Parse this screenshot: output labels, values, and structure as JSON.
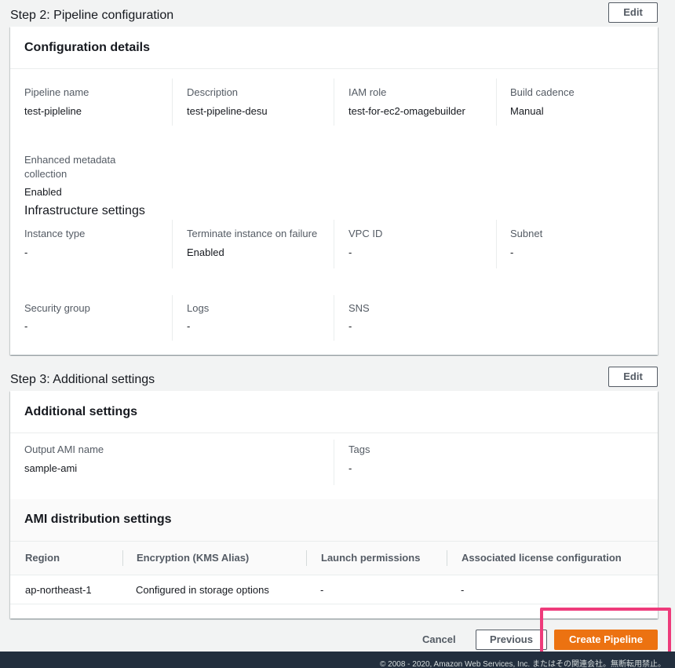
{
  "step2": {
    "title": "Step 2: Pipeline configuration",
    "edit_label": "Edit",
    "card_title": "Configuration details",
    "fields_row1": [
      {
        "label": "Pipeline name",
        "value": "test-pipleline"
      },
      {
        "label": "Description",
        "value": "test-pipeline-desu"
      },
      {
        "label": "IAM role",
        "value": "test-for-ec2-omagebuilder"
      },
      {
        "label": "Build cadence",
        "value": "Manual"
      }
    ],
    "enhanced": {
      "label_line1": "Enhanced metadata",
      "label_line2": "collection",
      "value": "Enabled"
    },
    "infra_title": "Infrastructure settings",
    "infra_row1": [
      {
        "label": "Instance type",
        "value": "-"
      },
      {
        "label": "Terminate instance on failure",
        "value": "Enabled"
      },
      {
        "label": "VPC ID",
        "value": "-"
      },
      {
        "label": "Subnet",
        "value": "-"
      }
    ],
    "infra_row2": [
      {
        "label": "Security group",
        "value": "-"
      },
      {
        "label": "Logs",
        "value": "-"
      },
      {
        "label": "SNS",
        "value": "-"
      }
    ]
  },
  "step3": {
    "title": "Step 3: Additional settings",
    "edit_label": "Edit",
    "card_title": "Additional settings",
    "fields": [
      {
        "label": "Output AMI name",
        "value": "sample-ami"
      },
      {
        "label": "Tags",
        "value": "-"
      }
    ],
    "dist_title": "AMI distribution settings",
    "table": {
      "headers": [
        "Region",
        "Encryption (KMS Alias)",
        "Launch permissions",
        "Associated license configuration"
      ],
      "rows": [
        [
          "ap-northeast-1",
          "Configured in storage options",
          "-",
          "-"
        ]
      ]
    }
  },
  "actions": {
    "cancel": "Cancel",
    "previous": "Previous",
    "create": "Create Pipeline"
  },
  "footer": {
    "text": "© 2008 - 2020, Amazon Web Services, Inc. またはその関連会社。無断転用禁止。"
  },
  "colors": {
    "primary": "#ec7211",
    "highlight": "#ee3b7b",
    "footer_bg": "#232f3e"
  }
}
